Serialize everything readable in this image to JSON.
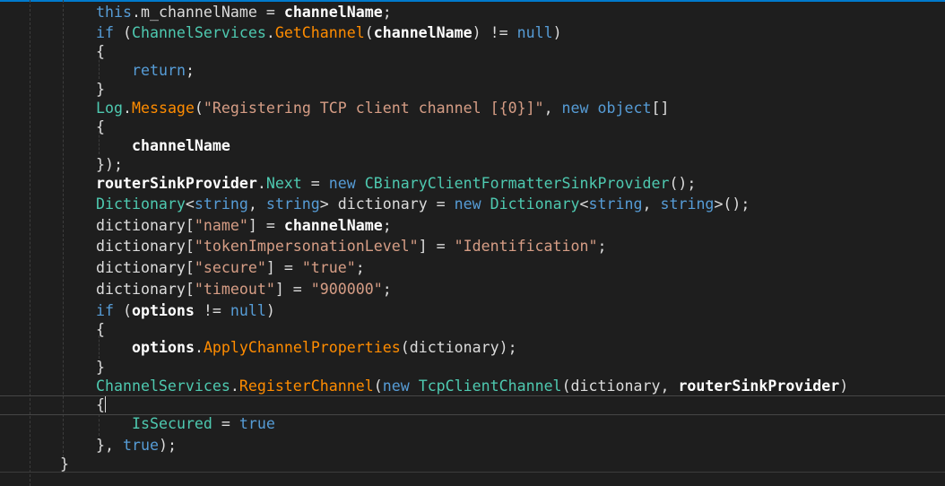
{
  "editor": {
    "lines": [
      {
        "t1": "this",
        "t2": ".",
        "t3": "m_channelName",
        "t4": " = ",
        "t5": "channelName",
        "t6": ";"
      },
      {
        "t1": "if",
        "t2": " (",
        "t3": "ChannelServices",
        "t4": ".",
        "t5": "GetChannel",
        "t6": "(",
        "t7": "channelName",
        "t8": ") != ",
        "t9": "null",
        "t10": ")"
      },
      {
        "t1": "{"
      },
      {
        "t1": "return",
        "t2": ";"
      },
      {
        "t1": "}"
      },
      {
        "t1": "Log",
        "t2": ".",
        "t3": "Message",
        "t4": "(",
        "t5": "\"Registering TCP client channel [{0}]\"",
        "t6": ", ",
        "t7": "new",
        "t8": " ",
        "t9": "object",
        "t10": "[]"
      },
      {
        "t1": "{"
      },
      {
        "t1": "channelName"
      },
      {
        "t1": "});"
      },
      {
        "t1": "routerSinkProvider",
        "t2": ".",
        "t3": "Next",
        "t4": " = ",
        "t5": "new",
        "t6": " ",
        "t7": "CBinaryClientFormatterSinkProvider",
        "t8": "();"
      },
      {
        "t1": "Dictionary",
        "t2": "<",
        "t3": "string",
        "t4": ", ",
        "t5": "string",
        "t6": "> dictionary = ",
        "t7": "new",
        "t8": " ",
        "t9": "Dictionary",
        "t10": "<",
        "t11": "string",
        "t12": ", ",
        "t13": "string",
        "t14": ">();"
      },
      {
        "t1": "dictionary[",
        "t2": "\"name\"",
        "t3": "] = ",
        "t4": "channelName",
        "t5": ";"
      },
      {
        "t1": "dictionary[",
        "t2": "\"tokenImpersonationLevel\"",
        "t3": "] = ",
        "t4": "\"Identification\"",
        "t5": ";"
      },
      {
        "t1": "dictionary[",
        "t2": "\"secure\"",
        "t3": "] = ",
        "t4": "\"true\"",
        "t5": ";"
      },
      {
        "t1": "dictionary[",
        "t2": "\"timeout\"",
        "t3": "] = ",
        "t4": "\"900000\"",
        "t5": ";"
      },
      {
        "t1": "if",
        "t2": " (",
        "t3": "options",
        "t4": " != ",
        "t5": "null",
        "t6": ")"
      },
      {
        "t1": "{"
      },
      {
        "t1": "options",
        "t2": ".",
        "t3": "ApplyChannelProperties",
        "t4": "(dictionary);"
      },
      {
        "t1": "}"
      },
      {
        "t1": "ChannelServices",
        "t2": ".",
        "t3": "RegisterChannel",
        "t4": "(",
        "t5": "new",
        "t6": " ",
        "t7": "TcpClientChannel",
        "t8": "(dictionary, ",
        "t9": "routerSinkProvider",
        "t10": ")"
      },
      {
        "t1": "{"
      },
      {
        "t1": "IsSecured",
        "t2": " = ",
        "t3": "true"
      },
      {
        "t1": "}, ",
        "t2": "true",
        "t3": ");"
      },
      {
        "t1": "}"
      }
    ]
  },
  "colors": {
    "background": "#1e1e1e",
    "keyword": "#569cd6",
    "type": "#4ec9b0",
    "method": "#ff8c00",
    "string": "#d69d85",
    "plain": "#dcdcdc",
    "identifier_bold": "#ffffff"
  }
}
